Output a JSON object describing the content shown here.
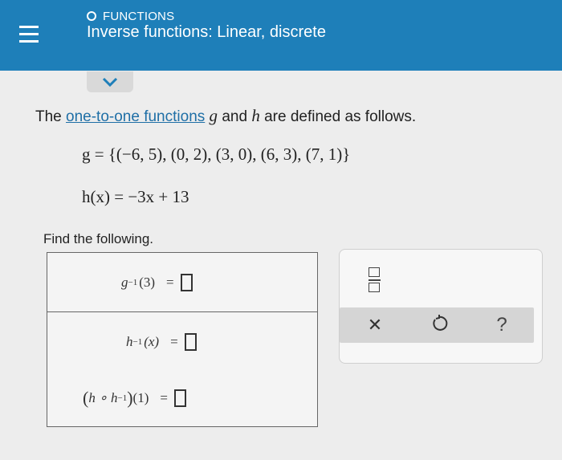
{
  "header": {
    "topic": "FUNCTIONS",
    "title": "Inverse functions: Linear, discrete",
    "accent_color": "#1e7fb9"
  },
  "problem": {
    "intro_prefix": "The ",
    "intro_link": "one-to-one functions",
    "intro_g": "g",
    "intro_and": " and ",
    "intro_h": "h",
    "intro_suffix": " are defined as follows.",
    "g_definition": "g = {(−6, 5), (0, 2), (3, 0), (6, 3), (7, 1)}",
    "h_definition": "h(x) = −3x + 13",
    "find_label": "Find the following."
  },
  "answers": {
    "row1": {
      "func": "g",
      "sup": "−1",
      "arg": "(3)",
      "eq": "="
    },
    "row2": {
      "func": "h",
      "sup": "−1",
      "arg": "(x)",
      "eq": "="
    },
    "row3": {
      "open": "(",
      "inner": "h ∘ h",
      "sup": "−1",
      "close": ")",
      "arg": "(1)",
      "eq": "="
    }
  },
  "toolbar": {
    "fraction_icon": "fraction-icon",
    "clear_icon": "close-icon",
    "undo_icon": "undo-icon",
    "help_label": "?"
  }
}
